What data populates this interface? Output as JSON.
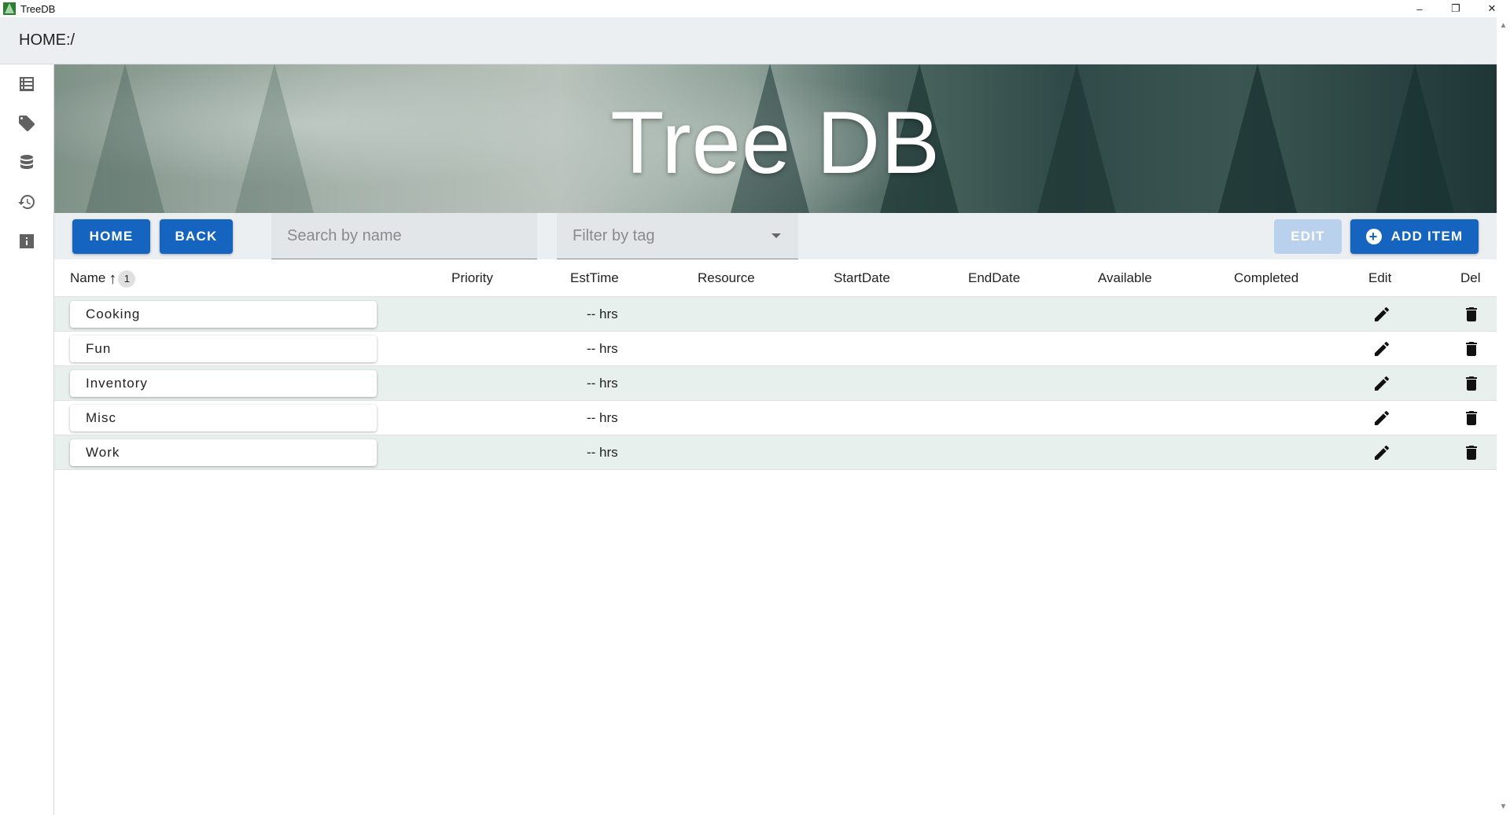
{
  "window": {
    "title": "TreeDB",
    "minimize_glyph": "–",
    "restore_glyph": "❐",
    "close_glyph": "✕"
  },
  "address": {
    "path": "HOME:/"
  },
  "sidebar": {
    "items": [
      {
        "icon": "list-icon"
      },
      {
        "icon": "tag-icon"
      },
      {
        "icon": "database-icon"
      },
      {
        "icon": "history-icon"
      },
      {
        "icon": "info-icon"
      }
    ]
  },
  "banner": {
    "title": "Tree DB"
  },
  "toolbar": {
    "home_label": "HOME",
    "back_label": "BACK",
    "search_placeholder": "Search by name",
    "filter_placeholder": "Filter by tag",
    "edit_label": "EDIT",
    "add_label": "ADD ITEM"
  },
  "table": {
    "headers": {
      "name": "Name",
      "sort_rank": "1",
      "priority": "Priority",
      "esttime": "EstTime",
      "resource": "Resource",
      "startdate": "StartDate",
      "enddate": "EndDate",
      "available": "Available",
      "completed": "Completed",
      "edit": "Edit",
      "del": "Del"
    },
    "rows": [
      {
        "name": "Cooking",
        "esttime": "-- hrs"
      },
      {
        "name": "Fun",
        "esttime": "-- hrs"
      },
      {
        "name": "Inventory",
        "esttime": "-- hrs"
      },
      {
        "name": "Misc",
        "esttime": "-- hrs"
      },
      {
        "name": "Work",
        "esttime": "-- hrs"
      }
    ]
  }
}
